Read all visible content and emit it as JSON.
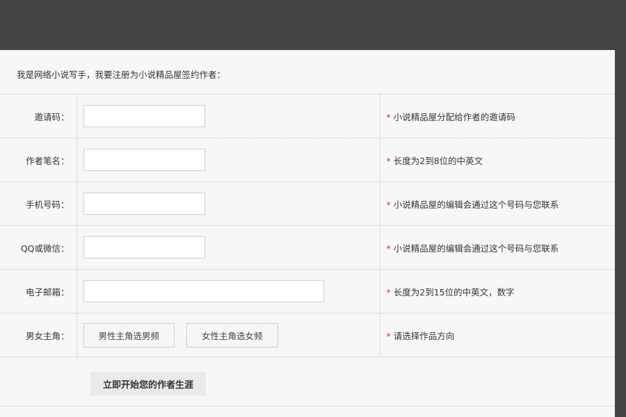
{
  "intro": "我是网络小说写手，我要注册为小说精品屋签约作者：",
  "fields": [
    {
      "label": "邀请码：",
      "hint": "小说精品屋分配给作者的邀请码"
    },
    {
      "label": "作者笔名：",
      "hint": "长度为2到8位的中英文"
    },
    {
      "label": "手机号码：",
      "hint": "小说精品屋的编辑会通过这个号码与您联系"
    },
    {
      "label": "QQ或微信：",
      "hint": "小说精品屋的编辑会通过这个号码与您联系"
    },
    {
      "label": "电子邮箱：",
      "hint": "长度为2到15位的中英文，数字"
    }
  ],
  "role": {
    "label": "男女主角：",
    "options": [
      "男性主角选男频",
      "女性主角选女频"
    ],
    "hint": "请选择作品方向"
  },
  "required_marker": "*",
  "submit_label": "立即开始您的作者生涯",
  "colors": {
    "accent_required": "#d52b2b",
    "page_bg": "#f7f7f7",
    "chrome_bg": "#444444"
  }
}
